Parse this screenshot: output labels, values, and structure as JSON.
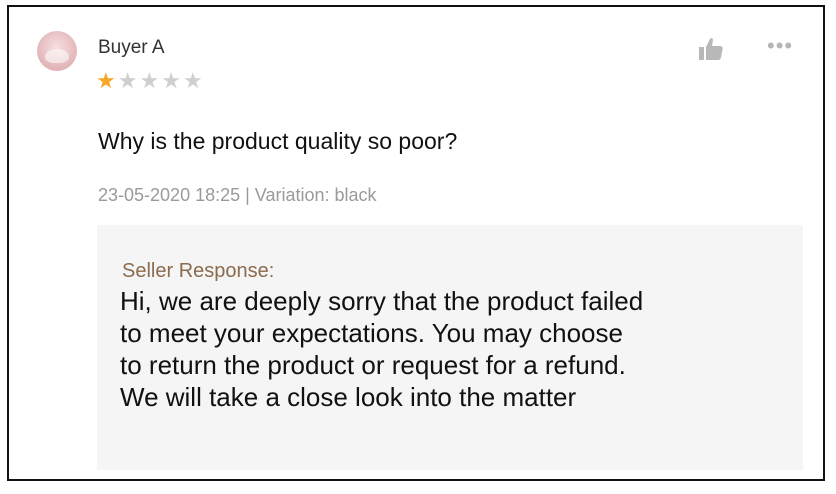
{
  "review": {
    "username": "Buyer A",
    "rating": 1,
    "max_rating": 5,
    "comment": "Why is the product quality so poor?",
    "meta": "23-05-2020 18:25 | Variation: black"
  },
  "actions": {
    "like_icon": "thumbs-up-icon",
    "more_icon": "more-dots-icon",
    "more_glyph": "•••"
  },
  "seller_response": {
    "title": "Seller Response:",
    "lines": [
      "Hi, we are deeply sorry that the product failed",
      "to meet your expectations. You may choose",
      "to return the product or request for a refund.",
      "We will take a close look into the matter"
    ]
  },
  "colors": {
    "star_filled": "#f5a623",
    "star_empty": "#cfcfcf",
    "response_title": "#8b6b4d",
    "response_bg": "#f5f5f5",
    "meta_text": "#9a9a9a"
  }
}
